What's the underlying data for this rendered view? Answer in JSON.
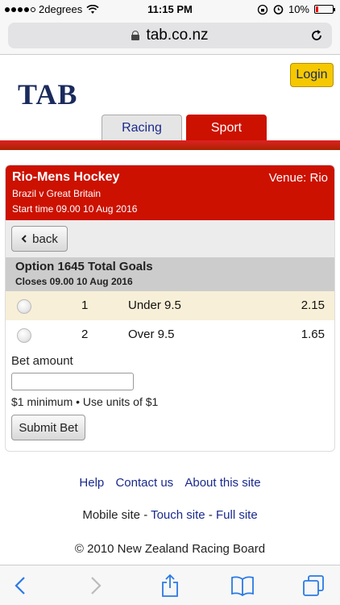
{
  "status_bar": {
    "carrier": "2degrees",
    "time": "11:15 PM",
    "battery": "10%",
    "battery_level_fraction": 0.1
  },
  "browser": {
    "url": "tab.co.nz"
  },
  "header": {
    "logo_text": "TAB",
    "login_label": "Login",
    "tabs": [
      {
        "label": "Racing",
        "active": false
      },
      {
        "label": "Sport",
        "active": true
      }
    ]
  },
  "event": {
    "title": "Rio-Mens Hockey",
    "venue": "Venue: Rio",
    "match": "Brazil v Great Britain",
    "start_time": "Start time 09.00 10 Aug 2016"
  },
  "back_label": "back",
  "option": {
    "title": "Option 1645 Total Goals",
    "closes": "Closes 09.00 10 Aug 2016",
    "selections": [
      {
        "number": "1",
        "label": "Under 9.5",
        "odds": "2.15",
        "highlighted": true
      },
      {
        "number": "2",
        "label": "Over 9.5",
        "odds": "1.65",
        "highlighted": false
      }
    ]
  },
  "bet": {
    "label": "Bet amount",
    "input_value": "",
    "hint": "$1 minimum • Use units of $1",
    "submit_label": "Submit Bet"
  },
  "footer": {
    "links": [
      "Help",
      "Contact us",
      "About this site"
    ],
    "mobile_prefix": "Mobile site -",
    "touch_site": "Touch site",
    "separator": "-",
    "full_site": "Full site",
    "copyright": "© 2010 New Zealand Racing Board"
  },
  "colors": {
    "brand_red": "#cc1100",
    "brand_navy": "#1a2a5c",
    "login_yellow": "#f5c800",
    "link_blue": "#1a2a8c",
    "ios_blue": "#2a7ae4"
  },
  "icons": {
    "wifi": "wifi-icon",
    "alarm": "alarm-icon",
    "lock": "lock-icon",
    "reload": "reload-icon",
    "back_arrow": "chevron-left-icon",
    "forward_arrow": "chevron-right-icon",
    "share": "share-icon",
    "bookmarks": "book-icon",
    "tabs": "tabs-icon"
  }
}
